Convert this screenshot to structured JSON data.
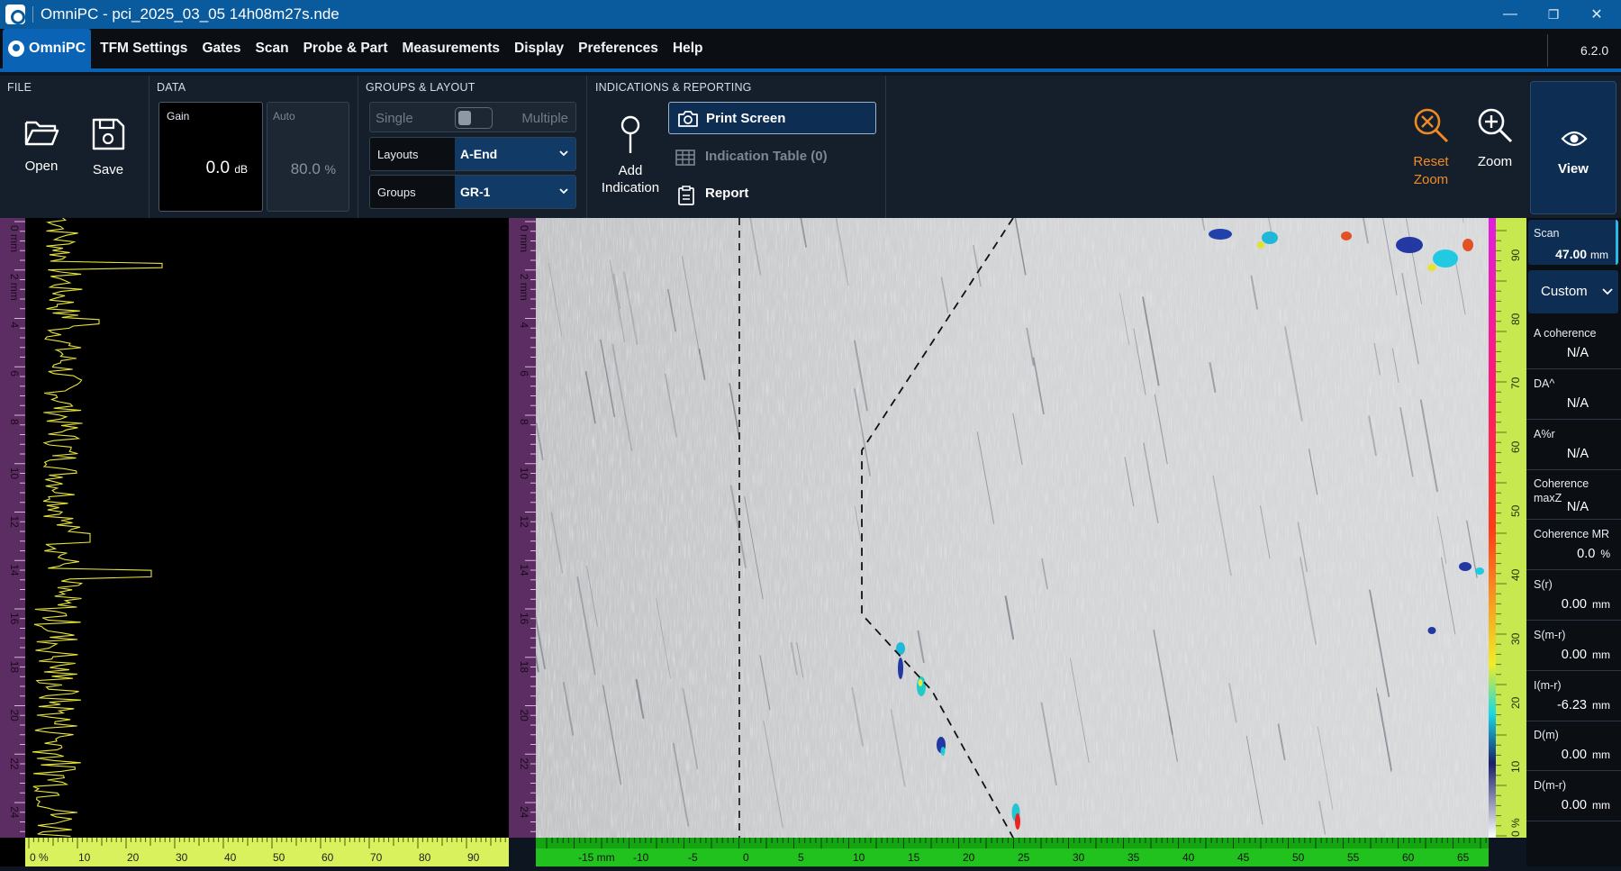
{
  "window": {
    "title": "OmniPC - pci_2025_03_05 14h08m27s.nde",
    "controls": [
      "—",
      "❐",
      "✕"
    ]
  },
  "menu": {
    "brand": "OmniPC",
    "items": [
      "TFM Settings",
      "Gates",
      "Scan",
      "Probe & Part",
      "Measurements",
      "Display",
      "Preferences",
      "Help"
    ],
    "version": "6.2.0"
  },
  "ribbon": {
    "file": {
      "label": "FILE",
      "open": "Open",
      "save": "Save"
    },
    "data": {
      "label": "DATA",
      "gain_label": "Gain",
      "gain_value": "0.0",
      "gain_unit": "dB",
      "auto_label": "Auto",
      "auto_value": "80.0",
      "auto_unit": "%"
    },
    "groups": {
      "label": "GROUPS & LAYOUT",
      "single": "Single",
      "multiple": "Multiple",
      "layouts_label": "Layouts",
      "layouts_value": "A-End",
      "groups_label": "Groups",
      "groups_value": "GR-1"
    },
    "indications": {
      "label": "INDICATIONS & REPORTING",
      "add_line1": "Add",
      "add_line2": "Indication",
      "print": "Print Screen",
      "table": "Indication Table (0)",
      "report": "Report"
    },
    "reset_line1": "Reset",
    "reset_line2": "Zoom",
    "zoom": "Zoom",
    "view": "View",
    "accent_orange": "#f08a24"
  },
  "ascan": {
    "left_ticks": [
      "0 mm",
      "2 mm",
      "4",
      "6",
      "8",
      "10",
      "12",
      "14",
      "16",
      "18",
      "20",
      "22",
      "24"
    ],
    "bottom_ticks": [
      "0 %",
      "10",
      "20",
      "30",
      "40",
      "50",
      "60",
      "70",
      "80",
      "90"
    ],
    "trace_color": "#e8e43a"
  },
  "sscan": {
    "bottom_ticks": [
      "-15 mm",
      "-10",
      "-5",
      "0",
      "5",
      "10",
      "15",
      "20",
      "25",
      "30",
      "35",
      "40",
      "45",
      "50",
      "55",
      "60",
      "65"
    ],
    "right_ticks": [
      "90",
      "80",
      "70",
      "60",
      "50",
      "40",
      "30",
      "20",
      "10",
      "0 %"
    ]
  },
  "readings": {
    "scan_label": "Scan",
    "scan_value": "47.00",
    "scan_unit": "mm",
    "selector": "Custom",
    "items": [
      {
        "label": "A coherence",
        "value": "N/A",
        "unit": ""
      },
      {
        "label": "DA^",
        "value": "N/A",
        "unit": ""
      },
      {
        "label": "A%r",
        "value": "N/A",
        "unit": ""
      },
      {
        "label": "Coherence maxZ",
        "value": "N/A",
        "unit": ""
      },
      {
        "label": "Coherence MR",
        "value": "0.0",
        "unit": "%"
      },
      {
        "label": "S(r)",
        "value": "0.00",
        "unit": "mm"
      },
      {
        "label": "S(m-r)",
        "value": "0.00",
        "unit": "mm"
      },
      {
        "label": "I(m-r)",
        "value": "-6.23",
        "unit": "mm"
      },
      {
        "label": "D(m)",
        "value": "0.00",
        "unit": "mm"
      },
      {
        "label": "D(m-r)",
        "value": "0.00",
        "unit": "mm"
      }
    ]
  }
}
